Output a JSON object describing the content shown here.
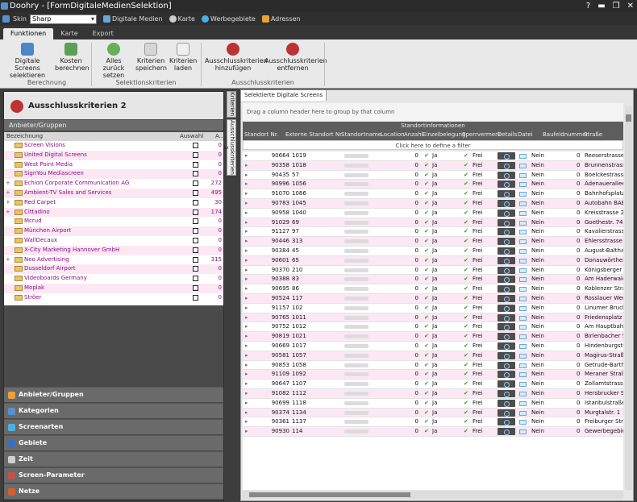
{
  "window": {
    "title": "Doohry - [FormDigitaleMedienSelektion]",
    "controls": [
      "✕",
      "🗗",
      "🗕",
      "▬",
      "🗗",
      "✕"
    ]
  },
  "quickbar": {
    "skin_label": "Skin",
    "skin_value": "Sharp",
    "links": [
      {
        "label": "Digitale Medien",
        "icon": "monitor-icon"
      },
      {
        "label": "Karte",
        "icon": "magnifier-icon"
      },
      {
        "label": "Werbegebiete",
        "icon": "globe-icon"
      },
      {
        "label": "Adressen",
        "icon": "contacts-icon"
      }
    ]
  },
  "tabs": [
    "Funktionen",
    "Karte",
    "Export"
  ],
  "ribbon": {
    "buttons": [
      {
        "l1": "Digitale Screens",
        "l2": "selektieren"
      },
      {
        "l1": "Kosten",
        "l2": "berechnen"
      },
      {
        "l1": "Alles zurück",
        "l2": "setzen"
      },
      {
        "l1": "Kriterien",
        "l2": "speichern"
      },
      {
        "l1": "Kriterien",
        "l2": "laden"
      },
      {
        "l1": "Ausschlusskriterien",
        "l2": "hinzufügen"
      },
      {
        "l1": "Ausschlusskriterien",
        "l2": "entfernen"
      }
    ],
    "groups": [
      "Berechnung",
      "Selektionskriterien",
      "Ausschlusskriterien"
    ]
  },
  "left": {
    "title": "Ausschlusskriterien 2",
    "group_header": "Anbieter/Gruppen",
    "cols": [
      "Bezeichnung",
      "Auswahl",
      "A..."
    ],
    "rows": [
      {
        "name": "Screen Visions",
        "exp": "",
        "cnt": "0"
      },
      {
        "name": "United Digital Screens",
        "exp": "",
        "cnt": "0"
      },
      {
        "name": "West Point Media",
        "exp": "",
        "cnt": "0"
      },
      {
        "name": "SignYou Mediascreen",
        "exp": "",
        "cnt": "0"
      },
      {
        "name": "Echion Corporate Communication AG",
        "exp": "+",
        "cnt": "272"
      },
      {
        "name": "Ambient-TV Sales and Services",
        "exp": "+",
        "cnt": "495"
      },
      {
        "name": "Red Carpet",
        "exp": "+",
        "cnt": "30"
      },
      {
        "name": "Cittadino",
        "exp": "+",
        "cnt": "174"
      },
      {
        "name": "Mcrud",
        "exp": "",
        "cnt": "0"
      },
      {
        "name": "München Airport",
        "exp": "",
        "cnt": "0"
      },
      {
        "name": "WallDecaux",
        "exp": "",
        "cnt": "0"
      },
      {
        "name": "X-City Marketing Hannover GmbH",
        "exp": "",
        "cnt": "0"
      },
      {
        "name": "Neo Advertising",
        "exp": "+",
        "cnt": "315"
      },
      {
        "name": "Dusseldorf Airport",
        "exp": "",
        "cnt": "0"
      },
      {
        "name": "Videoboards Germany",
        "exp": "",
        "cnt": "0"
      },
      {
        "name": "Moplak",
        "exp": "",
        "cnt": "0"
      },
      {
        "name": "Ströer",
        "exp": "",
        "cnt": "0"
      }
    ],
    "nav": [
      {
        "label": "Anbieter/Gruppen",
        "icon": "users-icon",
        "color": "#e9a23b"
      },
      {
        "label": "Kategorien",
        "icon": "category-icon",
        "color": "#5a8fd0"
      },
      {
        "label": "Screenarten",
        "icon": "star-icon",
        "color": "#4bb0e0"
      },
      {
        "label": "Gebiete",
        "icon": "map-icon",
        "color": "#3a6fc0"
      },
      {
        "label": "Zeit",
        "icon": "clock-icon",
        "color": "#d0d0d0"
      },
      {
        "label": "Screen-Parameter",
        "icon": "settings-icon",
        "color": "#c05050"
      },
      {
        "label": "Netze",
        "icon": "network-icon",
        "color": "#d06030"
      }
    ]
  },
  "vtabs": [
    "Kriterien",
    "Ausschlusskriterien 2"
  ],
  "right": {
    "tab": "Selektierte Digitale Screens",
    "group_hint": "Drag a column header here to group by that column",
    "band": "Standortinformationen",
    "cols": [
      "Standort Nr.",
      "Externe Standort Nr.",
      "Standortname",
      "Location",
      "Anzahl",
      "Einzelbelegung",
      "Sperrvermerk",
      "Details",
      "Datei",
      "",
      "Baufeldnummer",
      "Straße"
    ],
    "filter": "Click here to define a filter",
    "rows": [
      {
        "nr": "90664",
        "ext": "1019",
        "anz": "0",
        "str": "Reeserstrasse"
      },
      {
        "nr": "90358",
        "ext": "1018",
        "anz": "0",
        "str": "Brunnenstrasse"
      },
      {
        "nr": "90435",
        "ext": "57",
        "anz": "0",
        "str": "Boelckestrasse"
      },
      {
        "nr": "90996",
        "ext": "1056",
        "anz": "0",
        "str": "Adenauerallee"
      },
      {
        "nr": "91070",
        "ext": "1086",
        "anz": "0",
        "str": "Bahnhofsplatz"
      },
      {
        "nr": "90783",
        "ext": "1045",
        "anz": "0",
        "str": "Autobahn BAB"
      },
      {
        "nr": "90958",
        "ext": "1040",
        "anz": "0",
        "str": "Kreisstrasse 2"
      },
      {
        "nr": "91029",
        "ext": "69",
        "anz": "0",
        "str": "Goethestr. 74"
      },
      {
        "nr": "91127",
        "ext": "97",
        "anz": "0",
        "str": "Kavalierstrasse"
      },
      {
        "nr": "90446",
        "ext": "313",
        "anz": "0",
        "str": "Ehlersstrasse 3"
      },
      {
        "nr": "90384",
        "ext": "45",
        "anz": "0",
        "str": "August-Baltha"
      },
      {
        "nr": "90601",
        "ext": "65",
        "anz": "0",
        "str": "Donauwörther"
      },
      {
        "nr": "90370",
        "ext": "210",
        "anz": "0",
        "str": "Königsberger S"
      },
      {
        "nr": "90388",
        "ext": "83",
        "anz": "0",
        "str": "Am Haderwald"
      },
      {
        "nr": "90695",
        "ext": "86",
        "anz": "0",
        "str": "Koblenzer Stra"
      },
      {
        "nr": "90524",
        "ext": "117",
        "anz": "0",
        "str": "Rosslauer Weg"
      },
      {
        "nr": "91157",
        "ext": "102",
        "anz": "0",
        "str": "Linumer Bruch"
      },
      {
        "nr": "90765",
        "ext": "1011",
        "anz": "0",
        "str": "Friedensplatz -"
      },
      {
        "nr": "90752",
        "ext": "1012",
        "anz": "0",
        "str": "Am Hauptbahn"
      },
      {
        "nr": "90819",
        "ext": "1021",
        "anz": "0",
        "str": "Birlenbacher S"
      },
      {
        "nr": "90669",
        "ext": "1017",
        "anz": "0",
        "str": "Hindenburgstra"
      },
      {
        "nr": "90581",
        "ext": "1057",
        "anz": "0",
        "str": "Magirus-Straße"
      },
      {
        "nr": "90853",
        "ext": "1058",
        "anz": "0",
        "str": "Getrude-Barthe"
      },
      {
        "nr": "91109",
        "ext": "1092",
        "anz": "0",
        "str": "Meraner Straß"
      },
      {
        "nr": "90647",
        "ext": "1107",
        "anz": "0",
        "str": "Zollamtstrasse"
      },
      {
        "nr": "91082",
        "ext": "1112",
        "anz": "0",
        "str": "Hersbrucker St"
      },
      {
        "nr": "90699",
        "ext": "1118",
        "anz": "0",
        "str": "Istanbulstraße"
      },
      {
        "nr": "90374",
        "ext": "1134",
        "anz": "0",
        "str": "Murgtalstr. 1"
      },
      {
        "nr": "90361",
        "ext": "1137",
        "anz": "0",
        "str": "Freiburger Stra"
      },
      {
        "nr": "90930",
        "ext": "114",
        "anz": "0",
        "str": "Gewerbegebiet"
      }
    ],
    "einzel": "Ja",
    "sperr": "Frei",
    "datei": "Nein",
    "bauf": "0"
  }
}
